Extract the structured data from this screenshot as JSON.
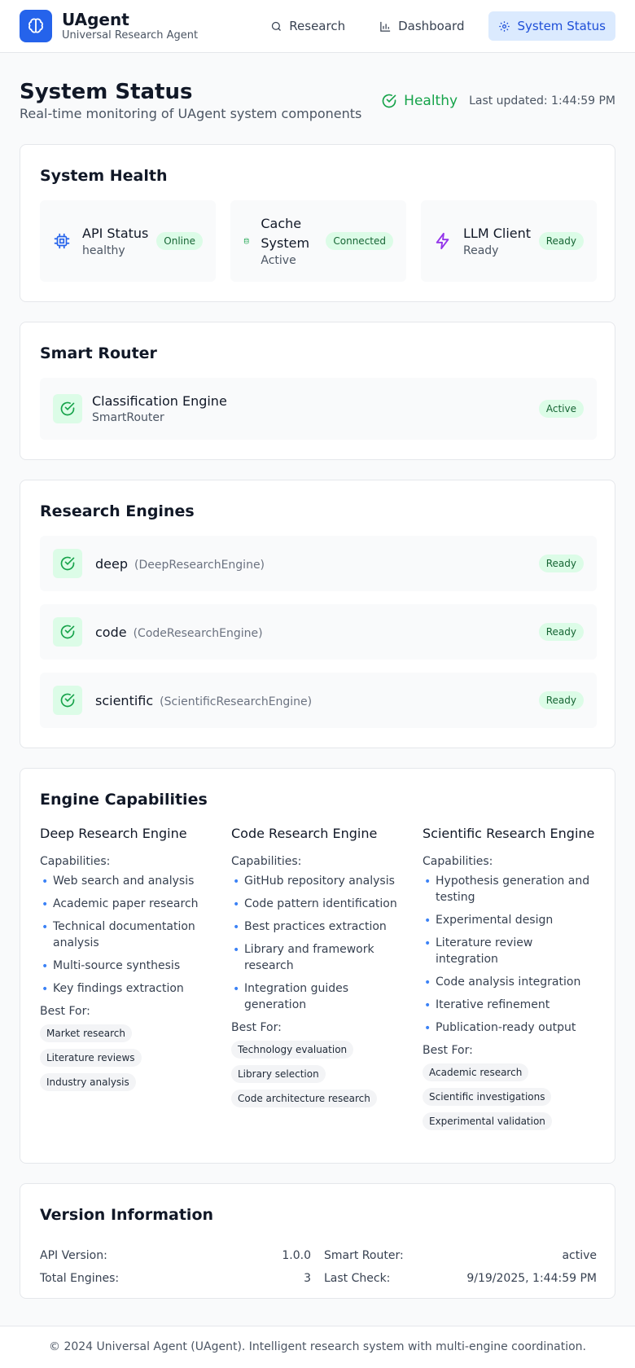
{
  "app": {
    "name": "UAgent",
    "subtitle": "Universal Research Agent"
  },
  "nav": {
    "research": "Research",
    "dashboard": "Dashboard",
    "system_status": "System Status"
  },
  "page": {
    "title": "System Status",
    "subtitle": "Real-time monitoring of UAgent system components",
    "health_label": "Healthy",
    "last_updated": "Last updated: 1:44:59 PM"
  },
  "system_health": {
    "title": "System Health",
    "items": [
      {
        "name": "API Status",
        "status": "healthy",
        "badge": "Online",
        "icon": "cpu-icon"
      },
      {
        "name": "Cache System",
        "status": "Active",
        "badge": "Connected",
        "icon": "database-icon"
      },
      {
        "name": "LLM Client",
        "status": "Ready",
        "badge": "Ready",
        "icon": "lightning-icon"
      }
    ]
  },
  "smart_router": {
    "title": "Smart Router",
    "name": "Classification Engine",
    "class": "SmartRouter",
    "badge": "Active"
  },
  "research_engines": {
    "title": "Research Engines",
    "items": [
      {
        "name": "deep",
        "class": "(DeepResearchEngine)",
        "badge": "Ready"
      },
      {
        "name": "code",
        "class": "(CodeResearchEngine)",
        "badge": "Ready"
      },
      {
        "name": "scientific",
        "class": "(ScientificResearchEngine)",
        "badge": "Ready"
      }
    ]
  },
  "capabilities": {
    "title": "Engine Capabilities",
    "capabilities_label": "Capabilities:",
    "best_for_label": "Best For:",
    "engines": [
      {
        "title": "Deep Research Engine",
        "items": [
          "Web search and analysis",
          "Academic paper research",
          "Technical documentation analysis",
          "Multi-source synthesis",
          "Key findings extraction"
        ],
        "best_for": [
          "Market research",
          "Literature reviews",
          "Industry analysis"
        ]
      },
      {
        "title": "Code Research Engine",
        "items": [
          "GitHub repository analysis",
          "Code pattern identification",
          "Best practices extraction",
          "Library and framework research",
          "Integration guides generation"
        ],
        "best_for": [
          "Technology evaluation",
          "Library selection",
          "Code architecture research"
        ]
      },
      {
        "title": "Scientific Research Engine",
        "items": [
          "Hypothesis generation and testing",
          "Experimental design",
          "Literature review integration",
          "Code analysis integration",
          "Iterative refinement",
          "Publication-ready output"
        ],
        "best_for": [
          "Academic research",
          "Scientific investigations",
          "Experimental validation"
        ]
      }
    ]
  },
  "version": {
    "title": "Version Information",
    "api_version_label": "API Version:",
    "api_version": "1.0.0",
    "total_engines_label": "Total Engines:",
    "total_engines": "3",
    "smart_router_label": "Smart Router:",
    "smart_router": "active",
    "last_check_label": "Last Check:",
    "last_check": "9/19/2025, 1:44:59 PM"
  },
  "footer": "© 2024 Universal Agent (UAgent). Intelligent research system with multi-engine coordination.",
  "colors": {
    "brand": "#2563eb",
    "healthy": "#16a34a",
    "badge_bg": "#dcfce7",
    "badge_text": "#166534",
    "bullet": "#3b82f6"
  }
}
